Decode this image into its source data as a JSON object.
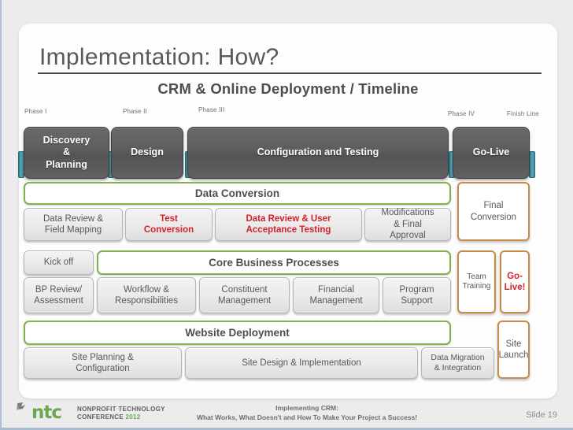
{
  "slide": {
    "title": "Implementation: How?",
    "subtitle": "CRM & Online Deployment / Timeline",
    "slide_number": "Slide 19"
  },
  "colors": {
    "dark_bar": "#5d5d5f",
    "green_border": "#84b14a",
    "orange_border": "#c88a48",
    "red_text": "#d2222a",
    "teal_connector": "#3d8ea0",
    "gray_text": "#58585a",
    "canvas": "#ececed"
  },
  "phase_labels": [
    {
      "text": "Phase I"
    },
    {
      "text": "Phase II"
    },
    {
      "text": "Phase III"
    },
    {
      "text": "Phase IV"
    },
    {
      "text": "Finish Line"
    }
  ],
  "phase_bars": [
    {
      "label": "Discovery & Planning",
      "line1": "Discovery",
      "line2": "&",
      "line3": "Planning"
    },
    {
      "label": "Design"
    },
    {
      "label": "Configuration and Testing"
    },
    {
      "label": "Go-Live"
    }
  ],
  "tracks": [
    {
      "name": "data-conversion",
      "band_label": "Data Conversion",
      "tasks": [
        {
          "label": "Data Review & Field Mapping",
          "style": "gray"
        },
        {
          "label": "Test Conversion",
          "style": "red"
        },
        {
          "label": "Data Review & User Acceptance Testing",
          "style": "red"
        },
        {
          "label": "Modifications & Final Approval",
          "style": "gray"
        }
      ],
      "milestone": {
        "label": "Final Conversion",
        "style": "orange"
      }
    },
    {
      "name": "core-business-processes",
      "band_label": "Core Business Processes",
      "lead_task": {
        "label": "Kick off",
        "style": "gray"
      },
      "tasks": [
        {
          "label": "BP Review/ Assessment",
          "style": "gray"
        },
        {
          "label": "Workflow & Responsibilities",
          "style": "gray"
        },
        {
          "label": "Constituent Management",
          "style": "gray"
        },
        {
          "label": "Financial Management",
          "style": "gray"
        },
        {
          "label": "Program Support",
          "style": "gray"
        }
      ],
      "milestones": [
        {
          "label": "Team Training",
          "style": "orange"
        },
        {
          "label": "Go- Live!",
          "style": "orange-red"
        }
      ]
    },
    {
      "name": "website-deployment",
      "band_label": "Website Deployment",
      "tasks": [
        {
          "label": "Site Planning & Configuration",
          "style": "gray"
        },
        {
          "label": "Site Design & Implementation",
          "style": "gray"
        },
        {
          "label": "Data Migration & Integration",
          "style": "gray"
        }
      ],
      "milestone": {
        "label": "Site Launch",
        "style": "orange"
      }
    }
  ],
  "footer": {
    "line1": "Implementing CRM:",
    "line2": "What Works, What Doesn't and How To Make Your Project a Success!",
    "logo": {
      "wordmark": "ntc",
      "tagline_line1": "NONPROFIT TECHNOLOGY",
      "tagline_line2": "CONFERENCE",
      "year": "2012"
    }
  }
}
